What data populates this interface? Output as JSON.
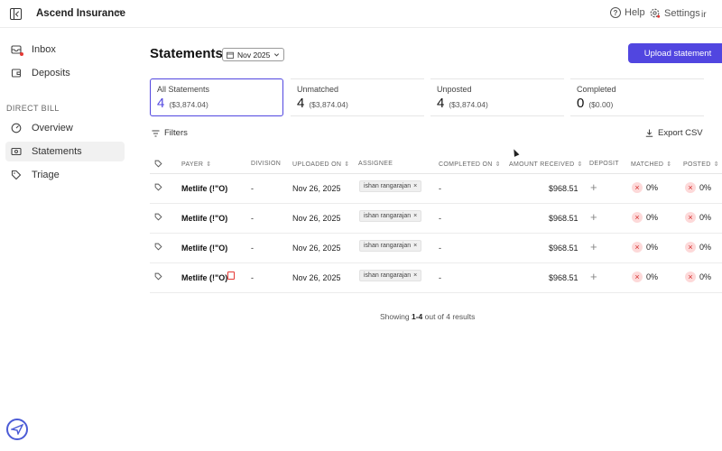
{
  "topbar": {
    "org_name": "Ascend Insurance",
    "help_label": "Help",
    "settings_label": "Settings",
    "avatar_initials": "ir"
  },
  "sidebar": {
    "items_top": [
      {
        "label": "Inbox",
        "icon": "inbox-icon"
      },
      {
        "label": "Deposits",
        "icon": "wallet-icon"
      }
    ],
    "section_label": "DIRECT BILL",
    "items_section": [
      {
        "label": "Overview",
        "icon": "gauge-icon"
      },
      {
        "label": "Statements",
        "icon": "statements-icon",
        "active": true
      },
      {
        "label": "Triage",
        "icon": "tag-icon"
      }
    ]
  },
  "header": {
    "title": "Statements",
    "date_value": "Nov 2025",
    "upload_label": "Upload statement"
  },
  "stats": [
    {
      "label": "All Statements",
      "count": "4",
      "amount": "($3,874.04)",
      "active": true
    },
    {
      "label": "Unmatched",
      "count": "4",
      "amount": "($3,874.04)"
    },
    {
      "label": "Unposted",
      "count": "4",
      "amount": "($3,874.04)"
    },
    {
      "label": "Completed",
      "count": "0",
      "amount": "($0.00)"
    }
  ],
  "toolbar": {
    "filters_label": "Filters",
    "export_label": "Export CSV"
  },
  "table": {
    "columns": [
      "PAYER",
      "DIVISION",
      "UPLOADED ON",
      "ASSIGNEE",
      "COMPLETED ON",
      "AMOUNT RECEIVED",
      "DEPOSIT",
      "MATCHED",
      "POSTED"
    ],
    "rows": [
      {
        "payer": "Metlife (!\"O)",
        "division": "-",
        "uploaded": "Nov 26, 2025",
        "assignee": "ishan rangarajan",
        "completed": "-",
        "amount": "$968.51",
        "matched": "0%",
        "posted": "0%",
        "flag": false
      },
      {
        "payer": "Metlife (!\"O)",
        "division": "-",
        "uploaded": "Nov 26, 2025",
        "assignee": "ishan rangarajan",
        "completed": "-",
        "amount": "$968.51",
        "matched": "0%",
        "posted": "0%",
        "flag": false
      },
      {
        "payer": "Metlife (!\"O)",
        "division": "-",
        "uploaded": "Nov 26, 2025",
        "assignee": "ishan rangarajan",
        "completed": "-",
        "amount": "$968.51",
        "matched": "0%",
        "posted": "0%",
        "flag": false
      },
      {
        "payer": "Metlife (!\"O)",
        "division": "-",
        "uploaded": "Nov 26, 2025",
        "assignee": "ishan rangarajan",
        "completed": "-",
        "amount": "$968.51",
        "matched": "0%",
        "posted": "0%",
        "flag": true
      }
    ]
  },
  "footer": {
    "prefix": "Showing ",
    "range": "1-4",
    "suffix": " out of 4 results"
  },
  "colors": {
    "accent": "#5146e0",
    "danger": "#d32f2f"
  }
}
